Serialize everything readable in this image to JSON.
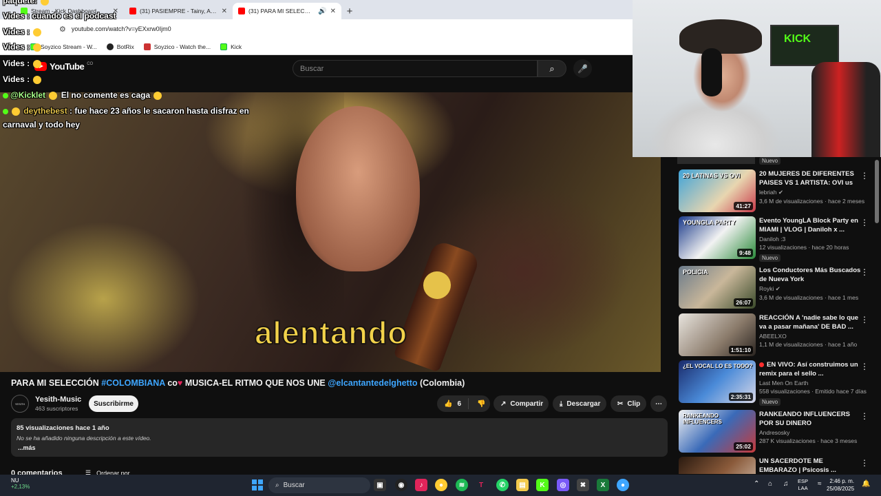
{
  "browser": {
    "tabs": [
      {
        "label": "Stream - Kick Dashboard",
        "favicon": "kick"
      },
      {
        "label": "(31) PASIEMPRE - Tainy, Arcang...",
        "favicon": "youtube"
      },
      {
        "label": "(31) PARA MI SELECCIÓN #...",
        "favicon": "youtube"
      }
    ],
    "url": "youtube.com/watch?v=yEXxrw0Ijm0",
    "bookmarks": [
      {
        "label": "Soyzico Stream - W..."
      },
      {
        "label": "BotRix"
      },
      {
        "label": "Soyzico - Watch the..."
      },
      {
        "label": "Kick"
      }
    ]
  },
  "youtube": {
    "logo_text": "YouTube",
    "country_code": "CO",
    "search_placeholder": "Buscar",
    "video_caption": "alentando",
    "title": {
      "part1": "PARA MI SELECCIÓN ",
      "tag1": "#COLOMBIANA",
      "part2": " co",
      "part3": " MUSICA-EL RITMO QUE NOS UNE ",
      "tag2": "@elcantantedelghetto",
      "part4": " (Colombia)"
    },
    "channel": {
      "name": "Yesith-Music",
      "subscribers": "463 suscriptores",
      "avatar_text": "YESITH"
    },
    "subscribe_label": "Suscribirme",
    "likes": "6",
    "share_label": "Compartir",
    "download_label": "Descargar",
    "clip_label": "Clip",
    "description": {
      "meta": "85 visualizaciones  hace 1 año",
      "text": "No se ha añadido ninguna descripción a este vídeo.",
      "more": "...más"
    },
    "comments_label": "0 comentarios",
    "sort_label": "Ordenar por"
  },
  "chat_overlay": {
    "line1": "paquete:",
    "line2": "Vides : cuando es el podcast",
    "line3": "Vides :",
    "line4": "Vides :",
    "line5": "Vides :",
    "line6": "Vides :",
    "msg1_user": "@Kicklet",
    "msg1_text": " El   no comente es caga",
    "msg2_user": "deythebest",
    "msg2_text": ": fue hace 23 años le sacaron hasta disfraz en",
    "msg2_cont": "carnaval y todo hey"
  },
  "sidebar": {
    "top_badge": "Nuevo",
    "videos": [
      {
        "title": "20 MUJERES DE DIFERENTES PAISES VS 1 ARTISTA: OVI us",
        "channel": "lebriah",
        "meta": "3,6 M de visualizaciones · hace 2 meses",
        "duration": "41:27",
        "thumb_text": "20 LATINAS VS OVI",
        "badge": ""
      },
      {
        "title": "Evento YoungLA Block Party en MIAMI | VLOG | Daniloh x ...",
        "channel": "Daniloh :3",
        "meta": "12 visualizaciones · hace 20 horas",
        "duration": "9:48",
        "thumb_text": "YOUNGLA PARTY",
        "badge": "Nuevo"
      },
      {
        "title": "Los Conductores Más Buscados de Nueva York",
        "channel": "Royki",
        "meta": "3,6 M de visualizaciones · hace 1 mes",
        "duration": "26:07",
        "thumb_text": "POLICIA",
        "badge": ""
      },
      {
        "title": "REACCIÓN A 'nadie sabe lo que va a pasar mañana' DE BAD ...",
        "channel": "ABEELXO",
        "meta": "1,1 M de visualizaciones · hace 1 año",
        "duration": "1:51:10",
        "thumb_text": "",
        "badge": ""
      },
      {
        "title": "EN VIVO: Así construimos un remix para el sello ...",
        "channel": "Last Men On Earth",
        "meta": "558 visualizaciones · Emitido hace 7 días",
        "duration": "2:35:31",
        "thumb_text": "¿EL VOCAL LO ES TODO?",
        "badge": "Nuevo"
      },
      {
        "title": "RANKEANDO INFLUENCERS POR SU DINERO",
        "channel": "Andresosky",
        "meta": "287 K visualizaciones · hace 3 meses",
        "duration": "25:02",
        "thumb_text": "RANKEANDO INFLUENCERS",
        "badge": ""
      },
      {
        "title": "UN SACERDOTE ME EMBARAZO | Psicosis ...",
        "channel": "",
        "meta": "",
        "duration": "",
        "thumb_text": "",
        "badge": ""
      }
    ]
  },
  "taskbar": {
    "weather_label": "NU",
    "weather_change": "+2,13%",
    "search_placeholder": "Buscar",
    "lang_line1": "ESP",
    "lang_line2": "LAA",
    "time": "2:46 p. m.",
    "date": "25/08/2025"
  }
}
